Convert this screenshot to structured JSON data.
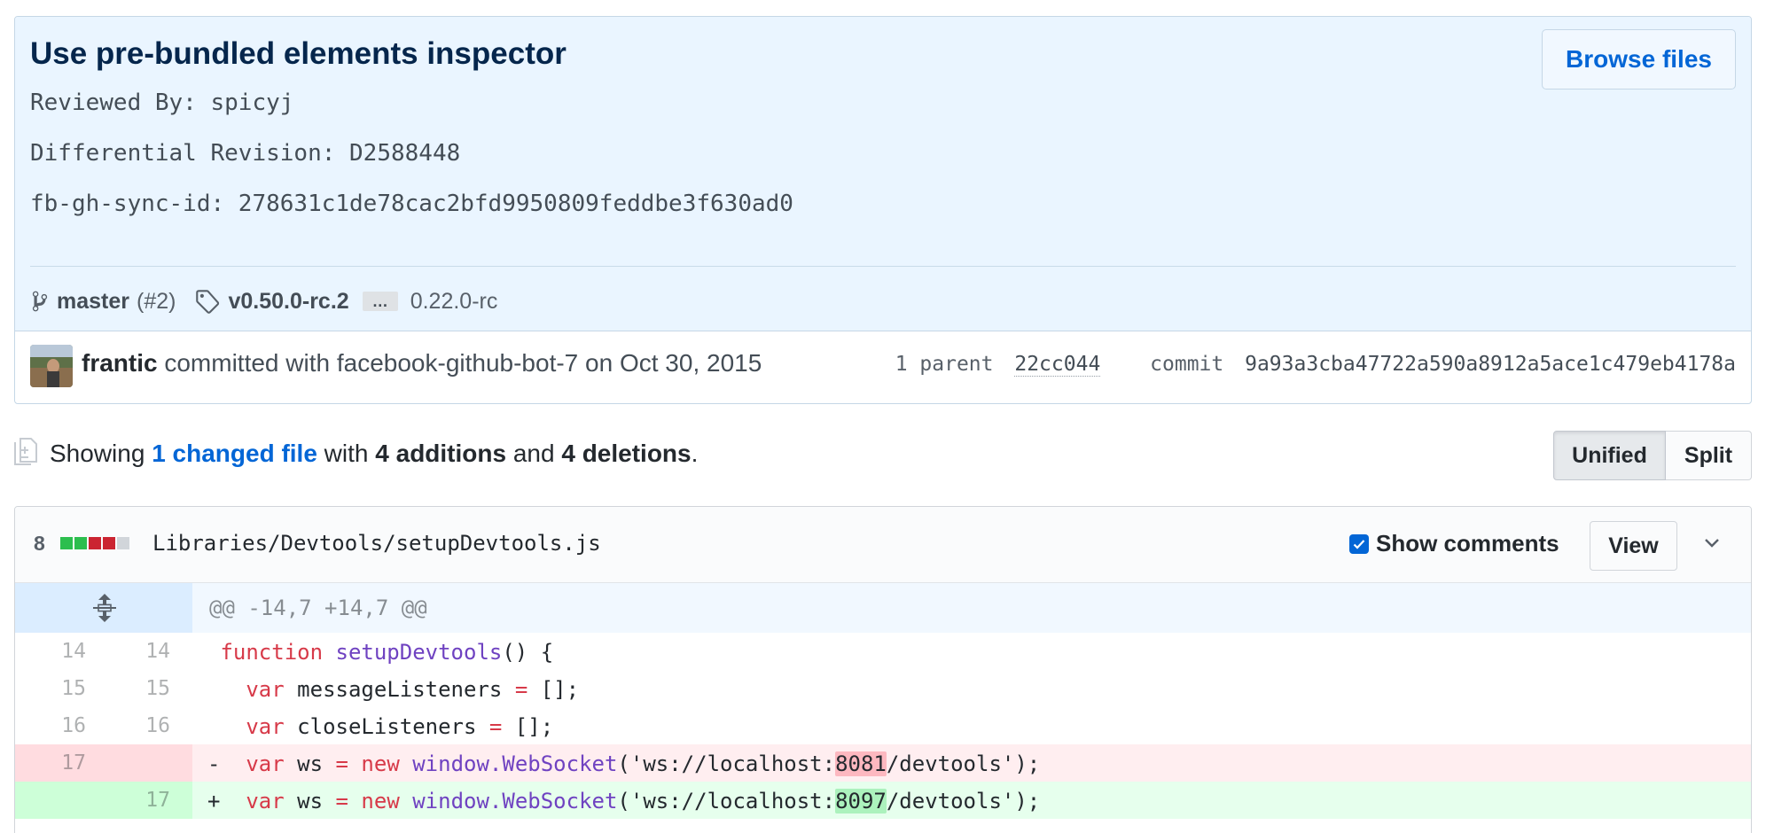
{
  "commit": {
    "title": "Use pre-bundled elements inspector",
    "browse_label": "Browse files",
    "description": [
      "Reviewed By: spicyj",
      "Differential Revision: D2588448",
      "fb-gh-sync-id: 278631c1de78cac2bfd9950809feddbe3f630ad0"
    ],
    "branch": "master",
    "branch_count": "(#2)",
    "tag": "v0.50.0-rc.2",
    "ellipsis": "…",
    "tag_old": "0.22.0-rc",
    "author": "frantic",
    "author_suffix": " committed with facebook-github-bot-7 on Oct 30, 2015",
    "parent_label": "1 parent",
    "parent_sha": "22cc044",
    "commit_label": "commit",
    "commit_sha": "9a93a3cba47722a590a8912a5ace1c479eb4178a"
  },
  "toc": {
    "showing": "Showing ",
    "changed_files": "1 changed file",
    "with": " with ",
    "additions": "4 additions",
    "and": " and ",
    "deletions": "4 deletions",
    "period": ".",
    "unified_label": "Unified",
    "split_label": "Split"
  },
  "file": {
    "diffstat_count": "8",
    "diffstat_colors": [
      "#2cbe4e",
      "#2cbe4e",
      "#cb2431",
      "#cb2431",
      "#d1d5da"
    ],
    "path": "Libraries/Devtools/setupDevtools.js",
    "show_comments_label": "Show comments",
    "view_label": "View",
    "hunk_header": "@@ -14,7 +14,7 @@",
    "lines": [
      {
        "old": "14",
        "new": "14"
      },
      {
        "old": "15",
        "new": "15"
      },
      {
        "old": "16",
        "new": "16"
      },
      {
        "old": "17",
        "new": ""
      },
      {
        "old": "",
        "new": "17"
      }
    ],
    "tokens": {
      "function_kw": "function",
      "fn_name": "setupDevtools",
      "fn_rest": "() {",
      "var_kw": "var",
      "msg_rest": " messageListeners ",
      "eq": "=",
      "arr_end": " [];",
      "close_rest": " closeListeners ",
      "ws_rest": " ws ",
      "new_kw": "new",
      "window_ws": "window.WebSocket",
      "url_pre": "('ws://localhost:",
      "port_old": "8081",
      "port_new": "8097",
      "url_post": "/devtools');",
      "minus": "-",
      "plus": "+"
    }
  },
  "colors": {
    "accent": "#0366d6",
    "header_bg": "#eaf5ff",
    "del_bg": "#ffeef0",
    "add_bg": "#e6ffed"
  }
}
